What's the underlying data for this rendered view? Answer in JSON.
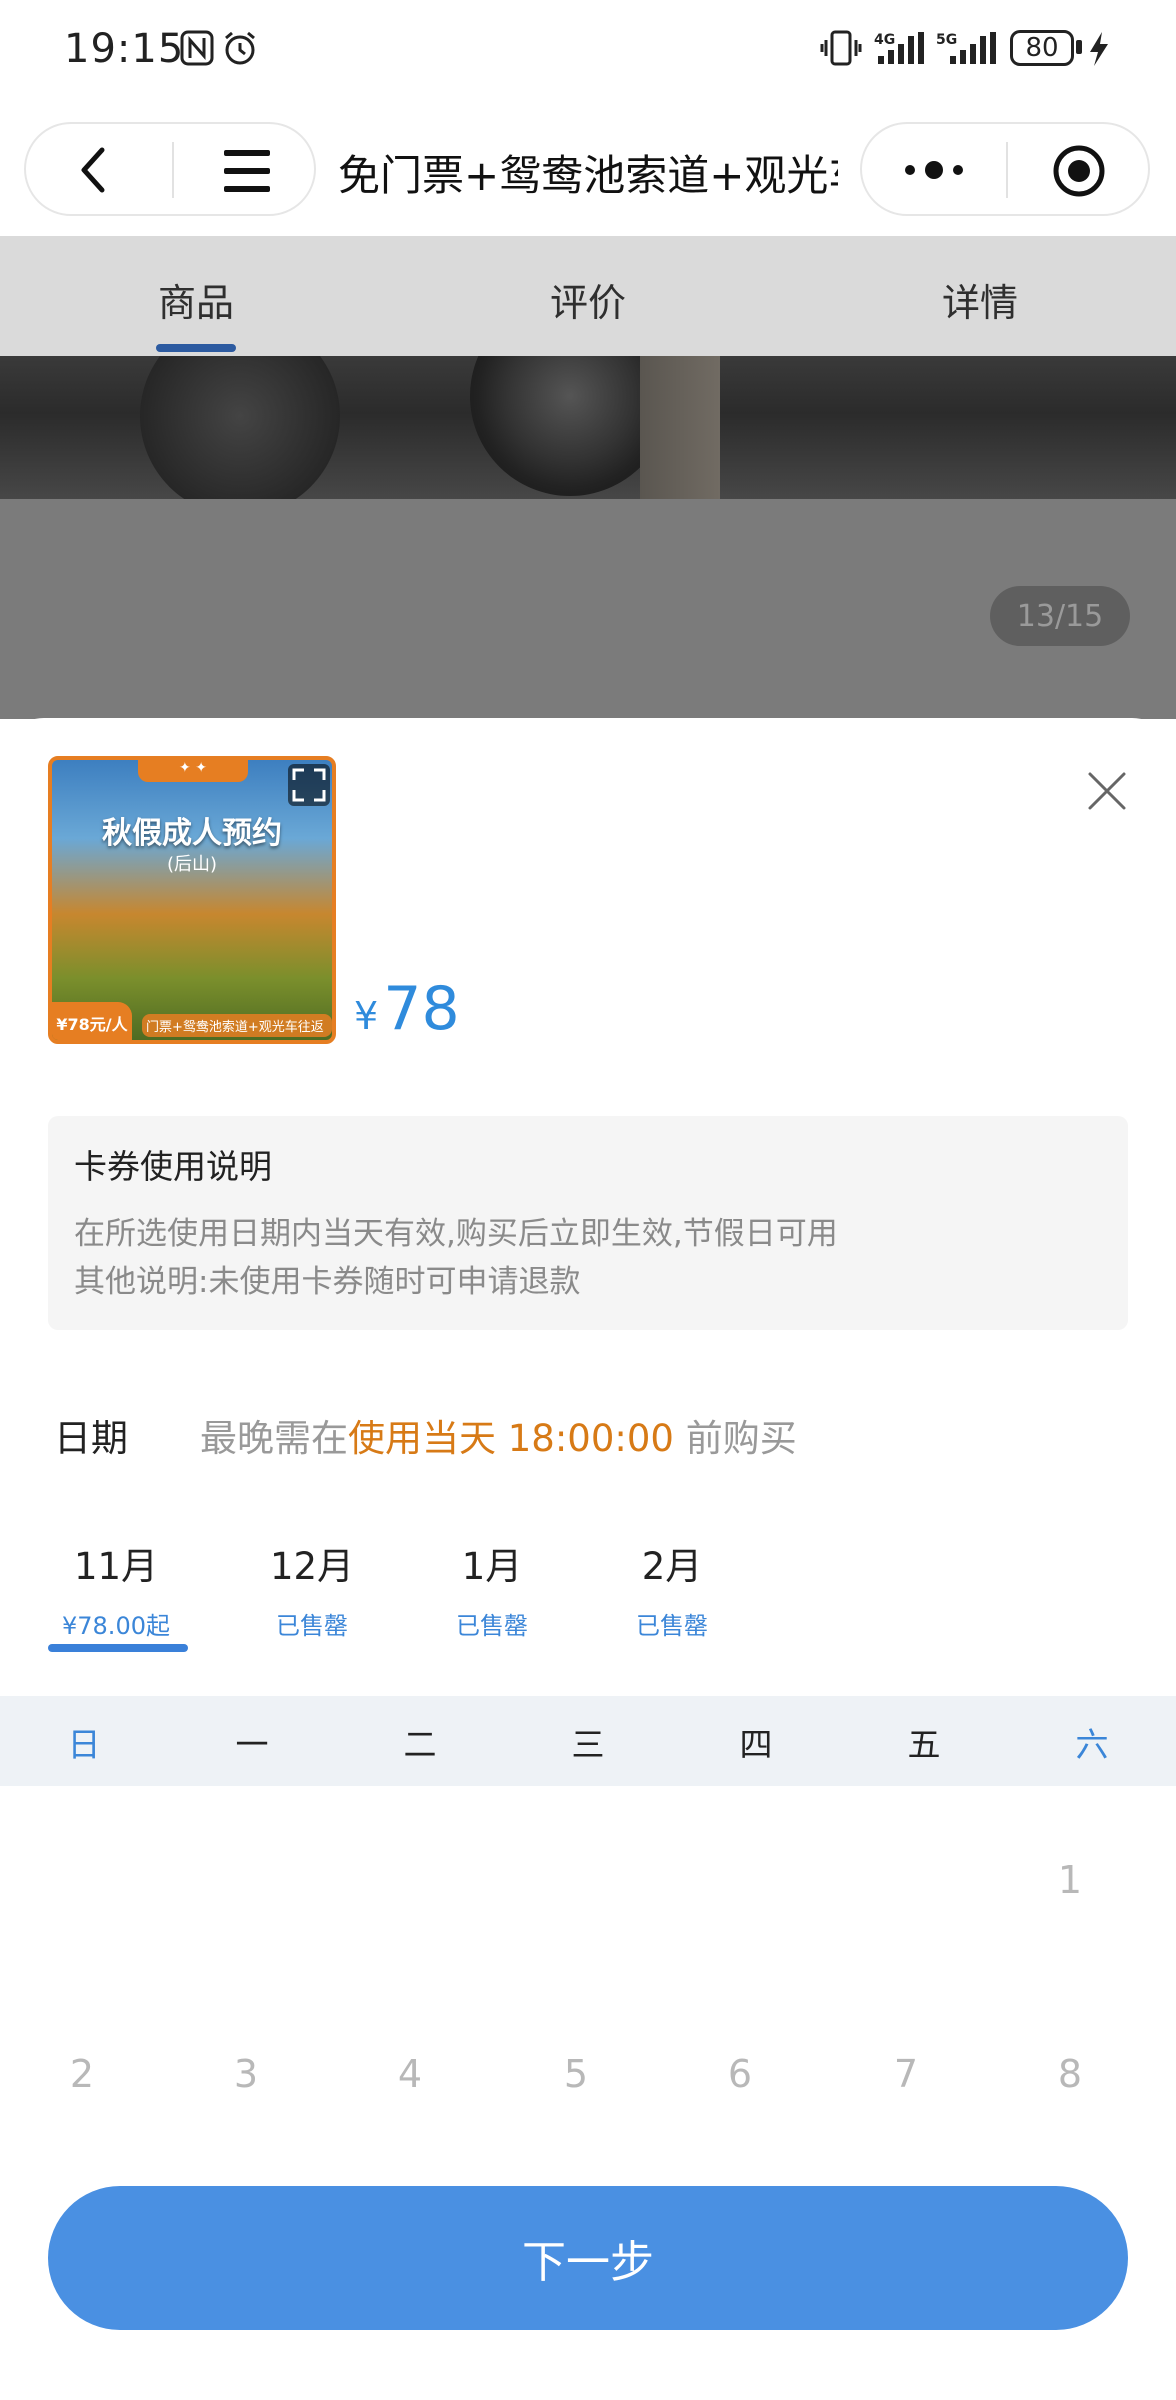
{
  "status_bar": {
    "time": "19:15",
    "battery": "80",
    "icons": [
      "nfc-icon",
      "alarm-icon",
      "vibrate-icon",
      "signal-4g-icon",
      "signal-5g-icon",
      "battery-icon",
      "charging-icon"
    ]
  },
  "nav": {
    "title": "免门票+鸳鸯池索道+观光车往返",
    "icons": [
      "back-icon",
      "menu-icon",
      "more-icon",
      "target-icon"
    ]
  },
  "tabs": [
    {
      "label": "商品",
      "active": true
    },
    {
      "label": "评价",
      "active": false
    },
    {
      "label": "详情",
      "active": false
    }
  ],
  "gallery": {
    "counter": "13/15"
  },
  "product": {
    "thumb_title": "秋假成人预约",
    "thumb_subtitle": "(后山)",
    "thumb_price": "¥78元/人",
    "thumb_caption": "门票+鸳鸯池索道+观光车往返",
    "price_symbol": "¥",
    "price": "78"
  },
  "usage": {
    "title": "卡券使用说明",
    "line1": "在所选使用日期内当天有效,购买后立即生效,节假日可用",
    "line2": "其他说明:未使用卡券随时可申请退款"
  },
  "date": {
    "label": "日期",
    "hint_prefix": "最晚需在",
    "hint_highlight": "使用当天 18:00:00",
    "hint_suffix": "前购买"
  },
  "months": [
    {
      "name": "11月",
      "sub": "¥78.00起",
      "active": true
    },
    {
      "name": "12月",
      "sub": "已售罄",
      "active": false
    },
    {
      "name": "1月",
      "sub": "已售罄",
      "active": false
    },
    {
      "name": "2月",
      "sub": "已售罄",
      "active": false
    }
  ],
  "weekdays": [
    "日",
    "一",
    "二",
    "三",
    "四",
    "五",
    "六"
  ],
  "calendar_days": [
    "1",
    "2",
    "3",
    "4",
    "5",
    "6",
    "7",
    "8"
  ],
  "next_button": "下一步",
  "colors": {
    "accent": "#4a90e2",
    "price": "#2f8bdc",
    "highlight": "#d77a16"
  }
}
